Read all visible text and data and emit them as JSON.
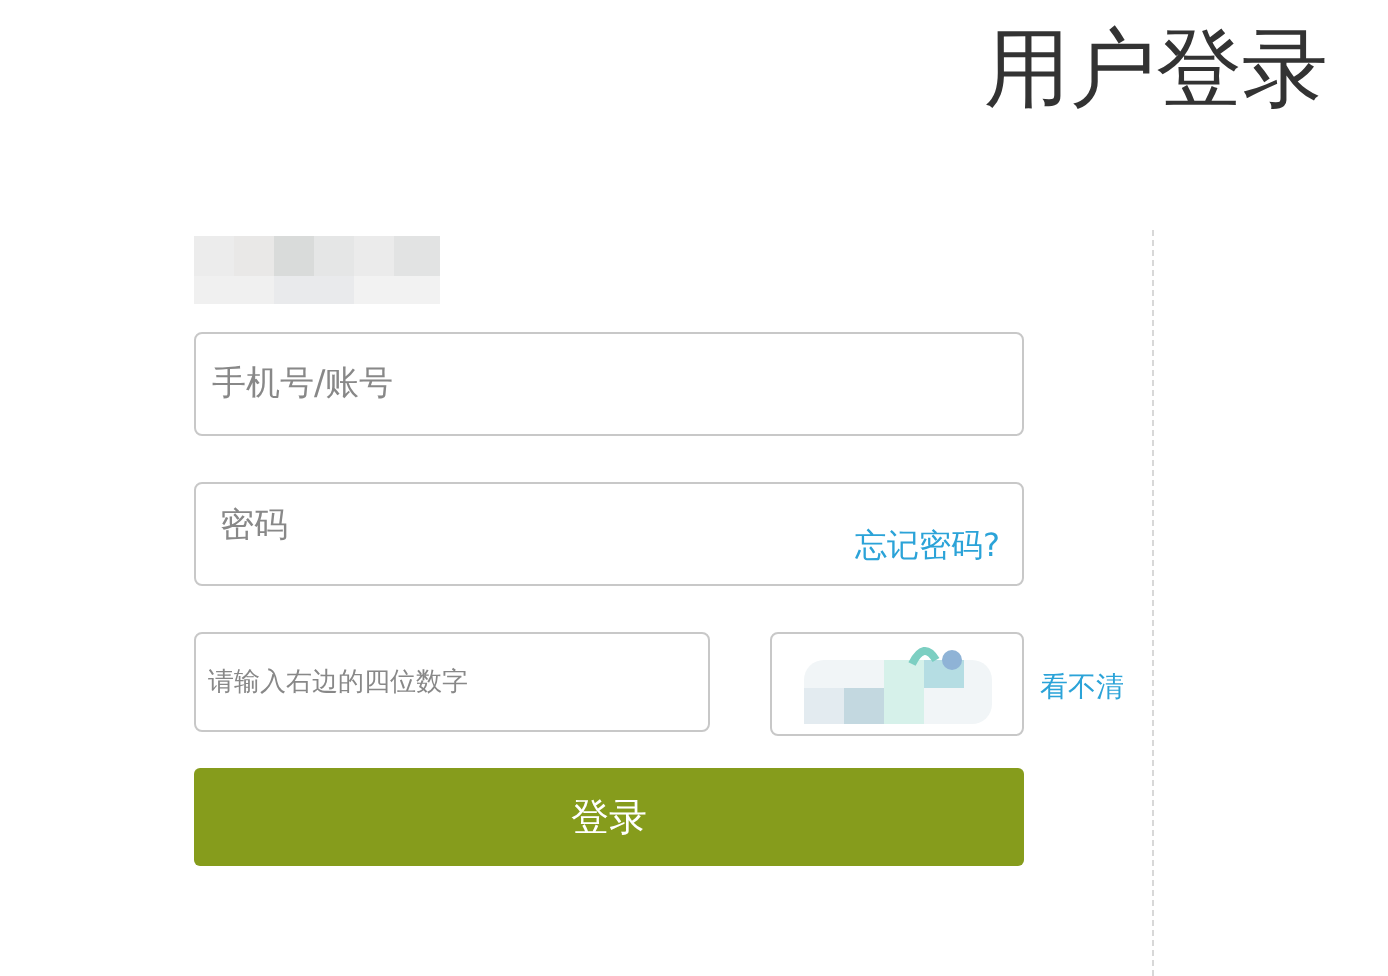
{
  "title": "用户登录",
  "account_field": {
    "placeholder": "手机号/账号"
  },
  "password_field": {
    "placeholder": "密码"
  },
  "forgot_link": "忘记密码?",
  "captcha_field": {
    "placeholder": "请输入右边的四位数字"
  },
  "captcha_refresh_link": "看不清",
  "login_button": "登录"
}
